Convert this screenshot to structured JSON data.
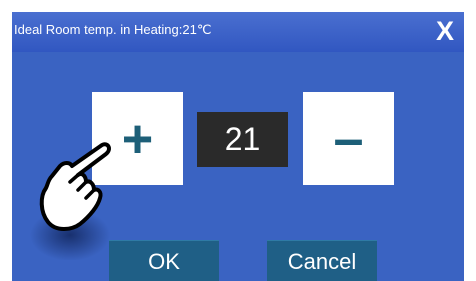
{
  "dialog": {
    "title": "Ideal Room temp. in Heating:21℃",
    "close_label": "X"
  },
  "stepper": {
    "plus_label": "+",
    "value": "21",
    "minus_label": "–"
  },
  "actions": {
    "ok_label": "OK",
    "cancel_label": "Cancel"
  },
  "colors": {
    "dialog_background": "#3a63c2",
    "button_background": "#1f5f86",
    "value_background": "#2a2a2a",
    "stepper_glyph": "#1d5f78"
  },
  "icons": {
    "pointer": "tapping-hand-icon"
  }
}
